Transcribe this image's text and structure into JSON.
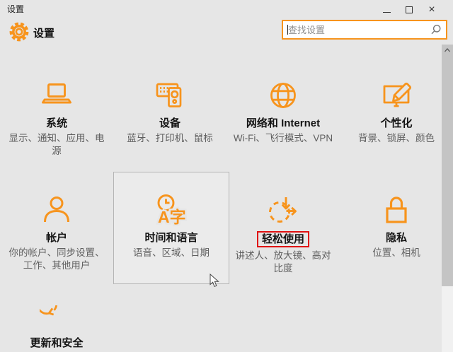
{
  "window": {
    "title": "设置",
    "controls": {
      "close_glyph": "×"
    }
  },
  "header": {
    "title": "设置"
  },
  "search": {
    "placeholder": "查找设置",
    "value": ""
  },
  "tiles": [
    {
      "id": "system",
      "icon": "laptop-icon",
      "title": "系统",
      "subtitle": "显示、通知、应用、电源"
    },
    {
      "id": "devices",
      "icon": "devices-icon",
      "title": "设备",
      "subtitle": "蓝牙、打印机、鼠标"
    },
    {
      "id": "network",
      "icon": "globe-icon",
      "title": "网络和 Internet",
      "subtitle": "Wi-Fi、飞行模式、VPN"
    },
    {
      "id": "personalization",
      "icon": "personalization-icon",
      "title": "个性化",
      "subtitle": "背景、锁屏、颜色"
    },
    {
      "id": "accounts",
      "icon": "user-icon",
      "title": "帐户",
      "subtitle": "你的帐户、同步设置、工作、其他用户"
    },
    {
      "id": "time-language",
      "icon": "clock-language-icon",
      "title": "时间和语言",
      "subtitle": "语音、区域、日期",
      "icon_text": "A字",
      "state": "hovered"
    },
    {
      "id": "ease-of-access",
      "icon": "ease-of-access-icon",
      "title": "轻松使用",
      "subtitle": "讲述人、放大镜、高对比度",
      "annotated": true
    },
    {
      "id": "privacy",
      "icon": "lock-icon",
      "title": "隐私",
      "subtitle": "位置、相机"
    },
    {
      "id": "update-security",
      "icon": "refresh-icon",
      "title": "更新和安全",
      "subtitle": ""
    }
  ],
  "annotation": {
    "color": "#e01010",
    "target": "轻松使用"
  },
  "colors": {
    "accent": "#f7941d",
    "background": "#e6e6e6",
    "title_text": "#141414",
    "subtitle_text": "#5f5f5f"
  }
}
